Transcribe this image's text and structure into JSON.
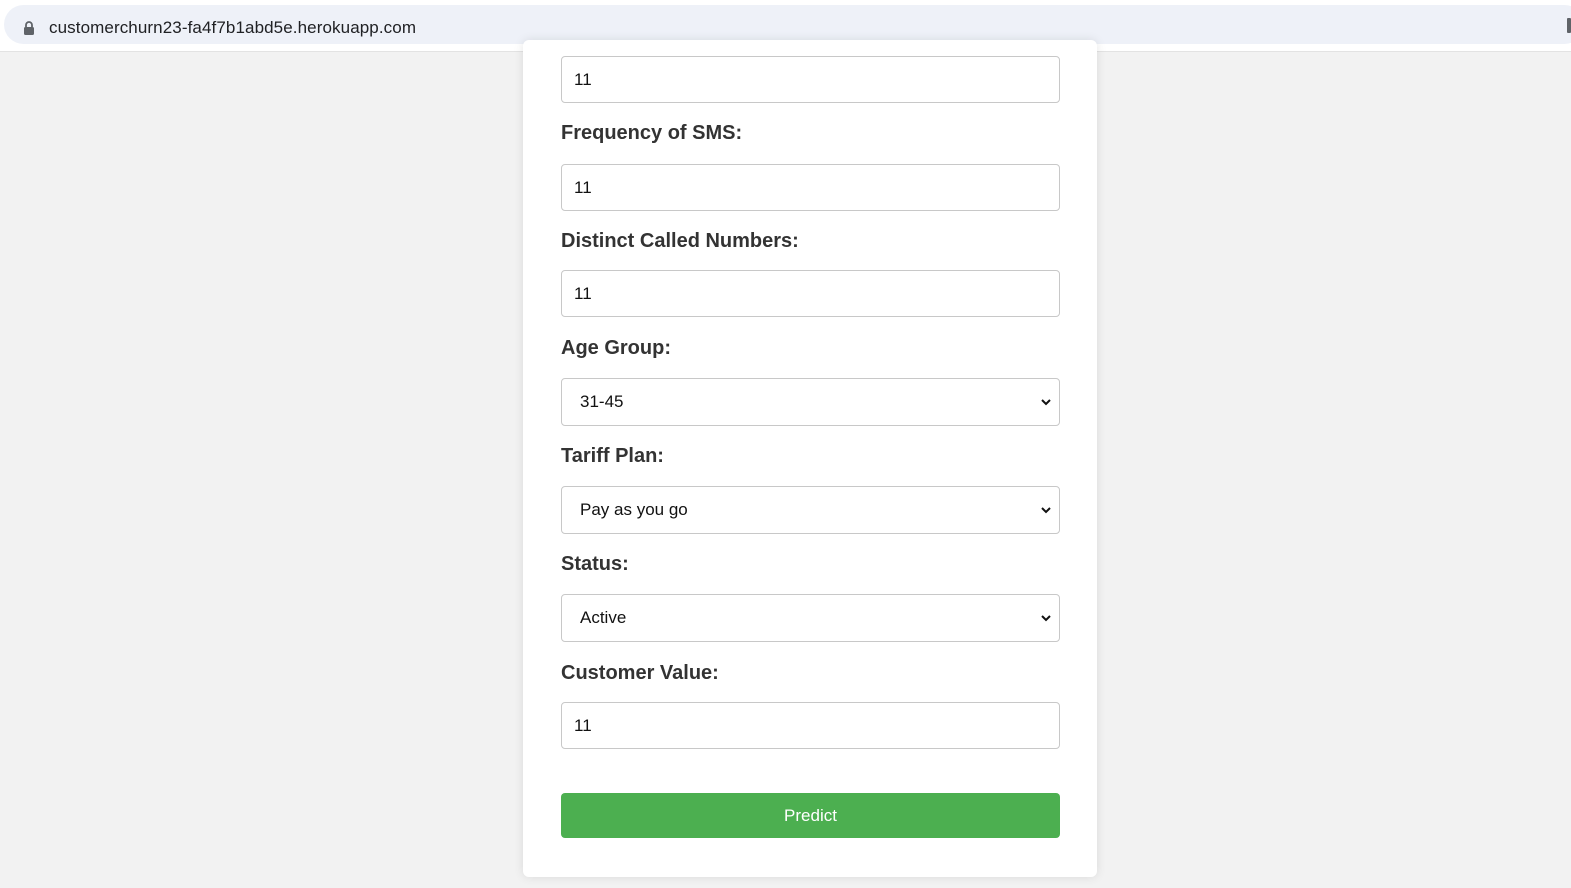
{
  "browser": {
    "url": "customerchurn23-fa4f7b1abd5e.herokuapp.com",
    "lock_icon": "lock-icon"
  },
  "form": {
    "top_input_value": "11",
    "frequency_of_sms": {
      "label": "Frequency of SMS:",
      "value": "11"
    },
    "distinct_called_numbers": {
      "label": "Distinct Called Numbers:",
      "value": "11"
    },
    "age_group": {
      "label": "Age Group:",
      "selected": "31-45"
    },
    "tariff_plan": {
      "label": "Tariff Plan:",
      "selected": "Pay as you go"
    },
    "status": {
      "label": "Status:",
      "selected": "Active"
    },
    "customer_value": {
      "label": "Customer Value:",
      "value": "11"
    },
    "predict_label": "Predict"
  },
  "colors": {
    "page_background": "#f2f2f2",
    "card_background": "#ffffff",
    "predict_button": "#4caf50",
    "label_text": "#333333"
  }
}
